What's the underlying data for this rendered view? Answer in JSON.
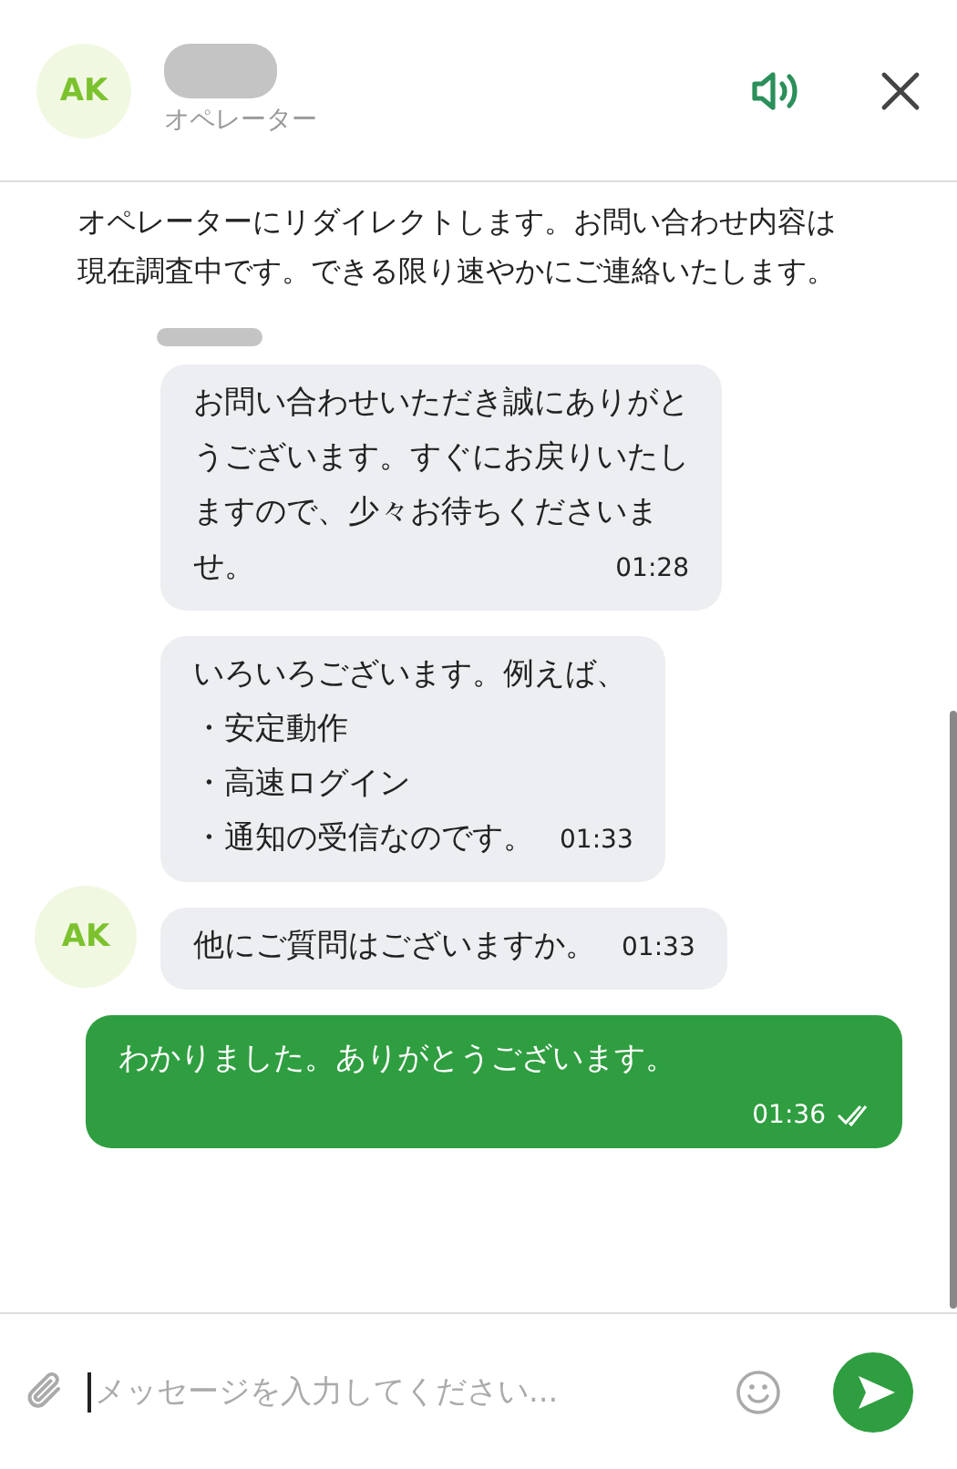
{
  "header": {
    "avatar_initials": "AK",
    "role": "オペレーター"
  },
  "messages": [
    {
      "kind": "system",
      "text": "オペレーターにリダイレクトします。お問い合わせ内容は現在調査中です。できる限り速やかにご連絡いたします。"
    },
    {
      "kind": "agent",
      "avatar": false,
      "show_sender": true,
      "lines": [
        "お問い合わせいただき誠にありがと",
        "うございます。すぐにお戻りいたし",
        "ますので、少々お待ちくださいま",
        "せ。"
      ],
      "time": "01:28"
    },
    {
      "kind": "agent",
      "avatar": false,
      "show_sender": false,
      "lines": [
        "いろいろございます。例えば、",
        "・安定動作",
        "・高速ログイン",
        "・通知の受信なのです。"
      ],
      "time": "01:33"
    },
    {
      "kind": "agent",
      "avatar": true,
      "avatar_initials": "AK",
      "show_sender": false,
      "lines": [
        "他にご質問はございますか。"
      ],
      "time": "01:33"
    },
    {
      "kind": "user",
      "read": true,
      "text": "わかりました。ありがとうございます。",
      "time": "01:36"
    }
  ],
  "composer": {
    "placeholder": "メッセージを入力してください..."
  }
}
